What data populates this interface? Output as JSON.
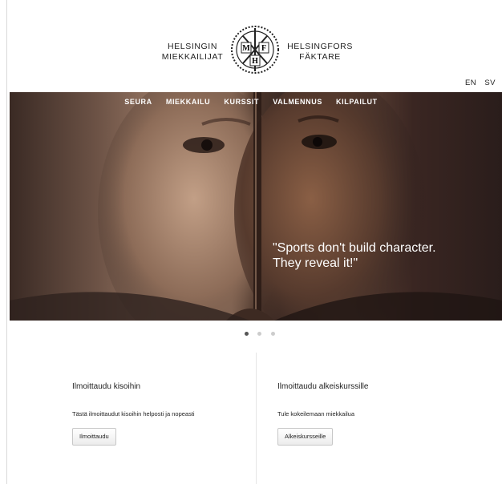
{
  "brand": {
    "left_line1": "HELSINGIN",
    "left_line2": "MIEKKAILIJAT",
    "right_line1": "HELSINGFORS",
    "right_line2": "FÄKTARE",
    "emblem_letters": [
      "M",
      "F",
      "H"
    ]
  },
  "lang": {
    "en": "EN",
    "sv": "SV"
  },
  "nav": [
    "SEURA",
    "MIEKKAILU",
    "KURSSIT",
    "VALMENNUS",
    "KILPAILUT"
  ],
  "hero": {
    "quote_line1": "\"Sports don't build character.",
    "quote_line2": "They reveal it!\""
  },
  "carousel": {
    "slides": 3,
    "active": 1
  },
  "cards": {
    "left": {
      "title": "Ilmoittaudu kisoihin",
      "text": "Tästä ilmoittaudut kisoihin helposti ja nopeasti",
      "button": "Ilmoittaudu"
    },
    "right": {
      "title": "Ilmoittaudu alkeiskurssille",
      "text": "Tule kokeilemaan miekkailua",
      "button": "Alkeiskursseille"
    }
  },
  "colors": {
    "hero_dark": "#2a1d1b",
    "hero_warm": "#a07e68",
    "text": "#222222",
    "accent_white": "#ffffff"
  }
}
